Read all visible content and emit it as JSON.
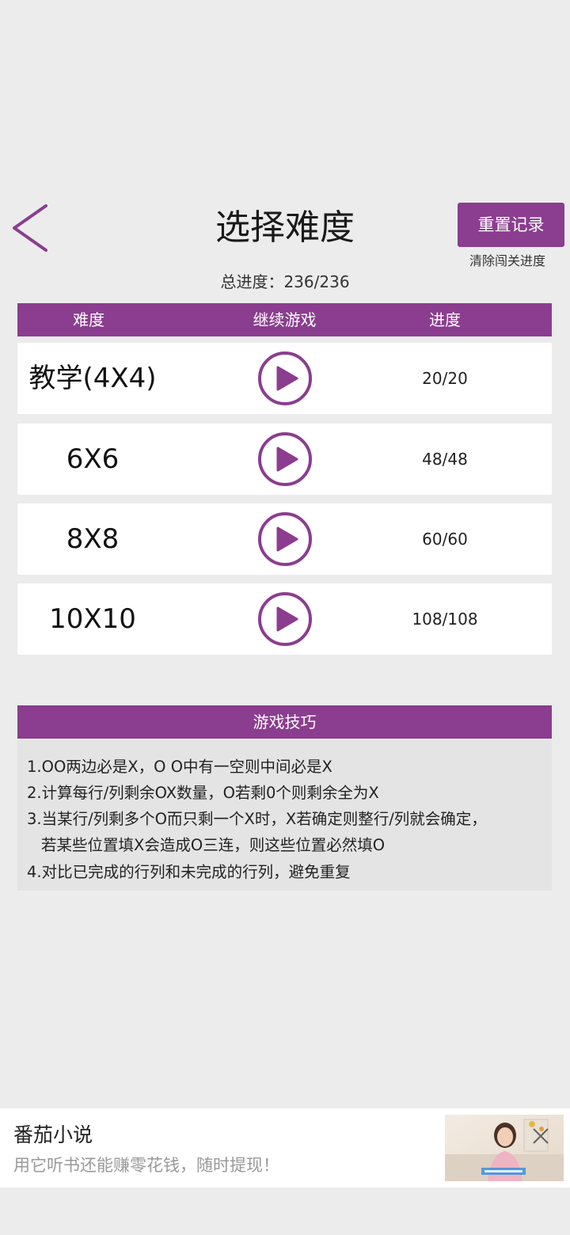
{
  "header": {
    "title": "选择难度",
    "reset_label": "重置记录",
    "reset_hint": "清除闯关进度",
    "total_progress": "总进度：236/236",
    "accent_color": "#8b3d8f"
  },
  "table": {
    "columns": [
      "难度",
      "继续游戏",
      "进度"
    ],
    "rows": [
      {
        "name": "教学(4X4)",
        "progress": "20/20"
      },
      {
        "name": "6X6",
        "progress": "48/48"
      },
      {
        "name": "8X8",
        "progress": "60/60"
      },
      {
        "name": "10X10",
        "progress": "108/108"
      }
    ]
  },
  "tips": {
    "title": "游戏技巧",
    "lines": [
      "1.OO两边必是X，O O中有一空则中间必是X",
      "2.计算每行/列剩余OX数量，O若剩0个则剩余全为X",
      "3.当某行/列剩多个O而只剩一个X时，X若确定则整行/列就会确定，",
      "若某些位置填X会造成O三连，则这些位置必然填O",
      "4.对比已完成的行列和未完成的行列，避免重复"
    ]
  },
  "ad": {
    "title": "番茄小说",
    "description": "用它听书还能赚零花钱，随时提现！",
    "image_icon": "ad-thumbnail-woman",
    "close_icon": "close-icon"
  }
}
